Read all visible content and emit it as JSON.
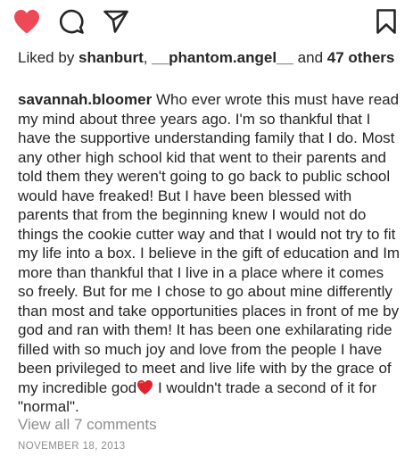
{
  "actions": {
    "like_icon": "heart-filled-icon",
    "comment_icon": "comment-bubble-icon",
    "share_icon": "paper-plane-icon",
    "save_icon": "bookmark-icon",
    "like_color": "#ed4956"
  },
  "likes": {
    "prefix": "Liked by ",
    "user1": "shanburt",
    "sep1": ", ",
    "user2": "__phantom.angel__",
    "sep2": " and ",
    "others": "47 others"
  },
  "caption": {
    "author": "savannah.bloomer",
    "text": "Who ever wrote this must have read my mind about three years ago. I'm so thankful that I have the supportive understanding family that I do. Most any other high school kid that went to their parents and told them they weren't going  to go back to public school would have freaked! But I have been blessed with parents that from the beginning knew I would not do things the cookie cutter way and that I would not try to fit my life into a box. I believe in the gift of education and Im more than thankful that I live in a place where it comes so freely. But for me I chose to go about mine differently than most and take opportunities places in front of me by god and ran with them! It has been one exhilarating ride filled with so much joy and love from the people I have been privileged to meet and live life with by the grace of my incredible god",
    "text_end": " I wouldn't trade a second of it for \"normal\".",
    "emoji": "red-heart-emoji"
  },
  "comments": {
    "view_all": "View all 7 comments"
  },
  "timestamp": "NOVEMBER 18, 2013"
}
